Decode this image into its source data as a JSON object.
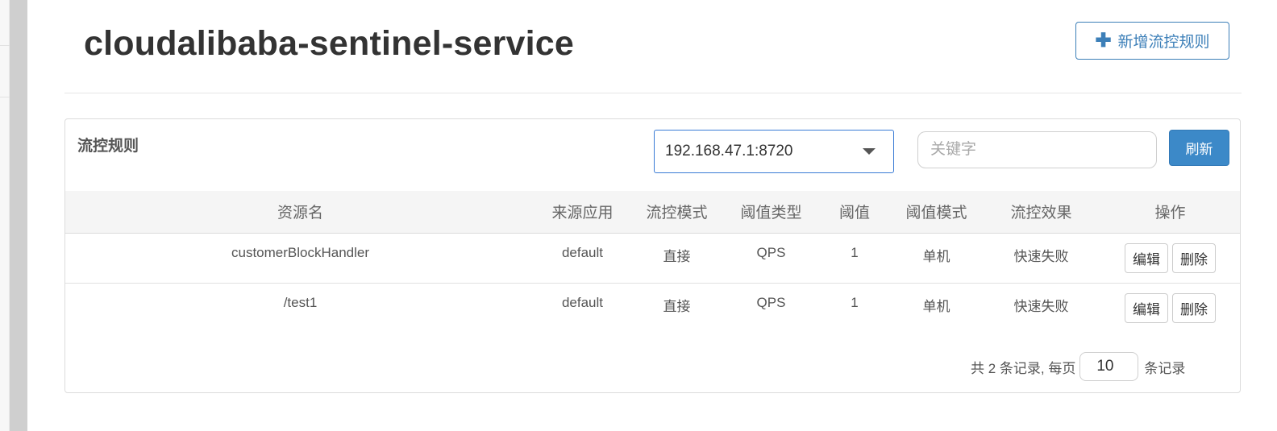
{
  "app": {
    "title": "cloudalibaba-sentinel-service",
    "add_button_label": "新增流控规则"
  },
  "panel": {
    "title": "流控规则",
    "machine_select_value": "192.168.47.1:8720",
    "search_placeholder": "关键字",
    "refresh_label": "刷新"
  },
  "table": {
    "columns": [
      "资源名",
      "来源应用",
      "流控模式",
      "阈值类型",
      "阈值",
      "阈值模式",
      "流控效果",
      "操作"
    ],
    "rows": [
      {
        "resource": "customerBlockHandler",
        "origin": "default",
        "mode": "直接",
        "grade": "QPS",
        "count": "1",
        "cluster": "单机",
        "effect": "快速失败",
        "edit": "编辑",
        "delete": "删除"
      },
      {
        "resource": "/test1",
        "origin": "default",
        "mode": "直接",
        "grade": "QPS",
        "count": "1",
        "cluster": "单机",
        "effect": "快速失败",
        "edit": "编辑",
        "delete": "删除"
      }
    ]
  },
  "pager": {
    "summary": "共 2 条记录, 每页",
    "page_size": "10",
    "suffix": "条记录"
  },
  "colors": {
    "accent": "#3c89c8",
    "title_text": "#333333"
  },
  "icons": {
    "add": "plus-icon",
    "dropdown": "caret-down-icon"
  }
}
